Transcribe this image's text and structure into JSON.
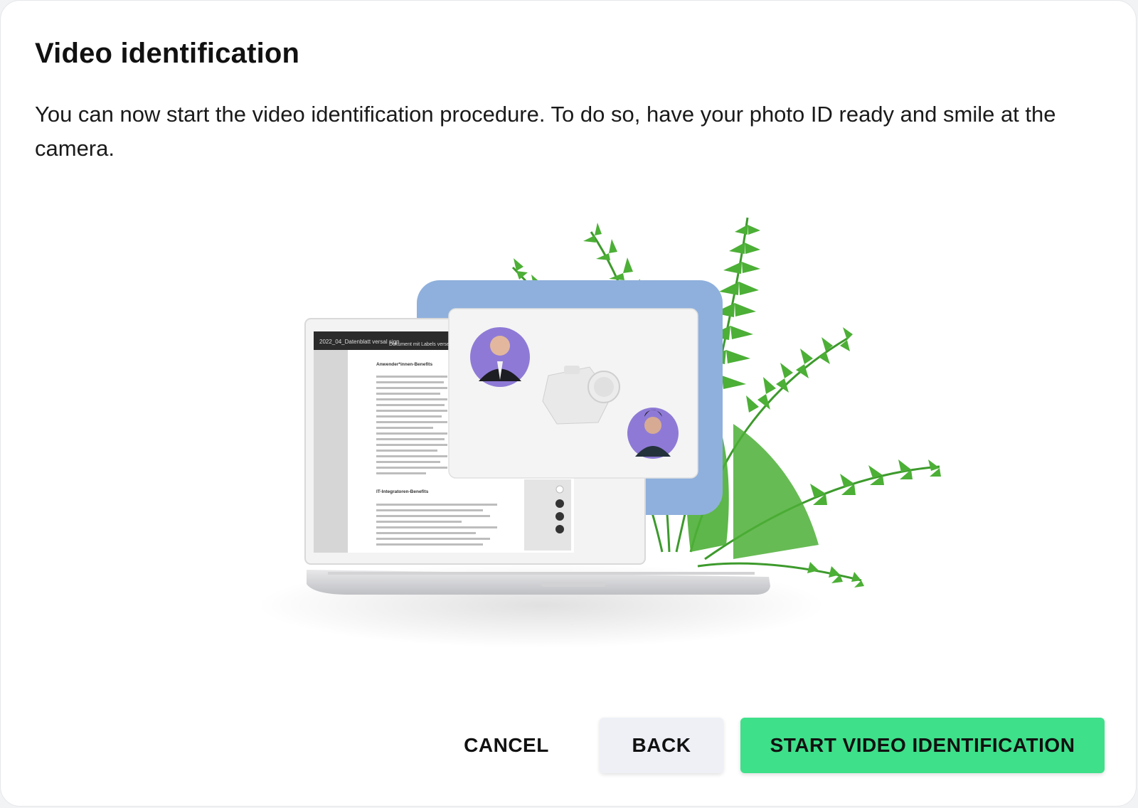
{
  "dialog": {
    "title": "Video identification",
    "description": "You can now start the video identification procedure. To do so, have your photo ID ready and smile at the camera."
  },
  "illustration": {
    "doc_header_link": "2022_04_Datenblatt versal sign",
    "doc_header_title": "Dokument mit Labels versehen",
    "section1_heading": "Anwender*innen-Benefits",
    "section2_heading": "IT-Integratoren-Benefits"
  },
  "actions": {
    "cancel_label": "CANCEL",
    "back_label": "BACK",
    "start_label": "START VIDEO IDENTIFICATION"
  },
  "colors": {
    "primary": "#3ee08a",
    "secondary_button": "#eef0f6",
    "text": "#111111",
    "accent_panel": "#8fb0dc"
  }
}
